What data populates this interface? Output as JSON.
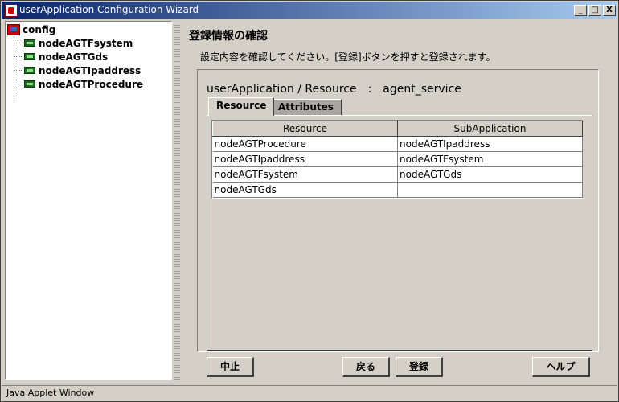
{
  "window": {
    "title": "userApplication Configuration Wizard",
    "minimize_label": "_",
    "maximize_label": "□",
    "close_label": "X"
  },
  "tree": {
    "root": "config",
    "items": [
      {
        "label": "nodeAGTFsystem"
      },
      {
        "label": "nodeAGTGds"
      },
      {
        "label": "nodeAGTIpaddress"
      },
      {
        "label": "nodeAGTProcedure"
      }
    ]
  },
  "main": {
    "heading": "登録情報の確認",
    "description": "設定内容を確認してください。[登録]ボタンを押すと登録されます。",
    "content_title": "userApplication / Resource　:　agent_service",
    "tabs": [
      {
        "label": "Resource",
        "active": true
      },
      {
        "label": "Attributes",
        "active": false
      }
    ],
    "table": {
      "columns": [
        "Resource",
        "SubApplication"
      ],
      "rows": [
        [
          "nodeAGTProcedure",
          "nodeAGTIpaddress"
        ],
        [
          "nodeAGTIpaddress",
          "nodeAGTFsystem"
        ],
        [
          "nodeAGTFsystem",
          "nodeAGTGds"
        ],
        [
          "nodeAGTGds",
          ""
        ]
      ]
    }
  },
  "buttons": {
    "cancel": "中止",
    "back": "戻る",
    "register": "登録",
    "help": "ヘルプ"
  },
  "status": "Java Applet Window"
}
